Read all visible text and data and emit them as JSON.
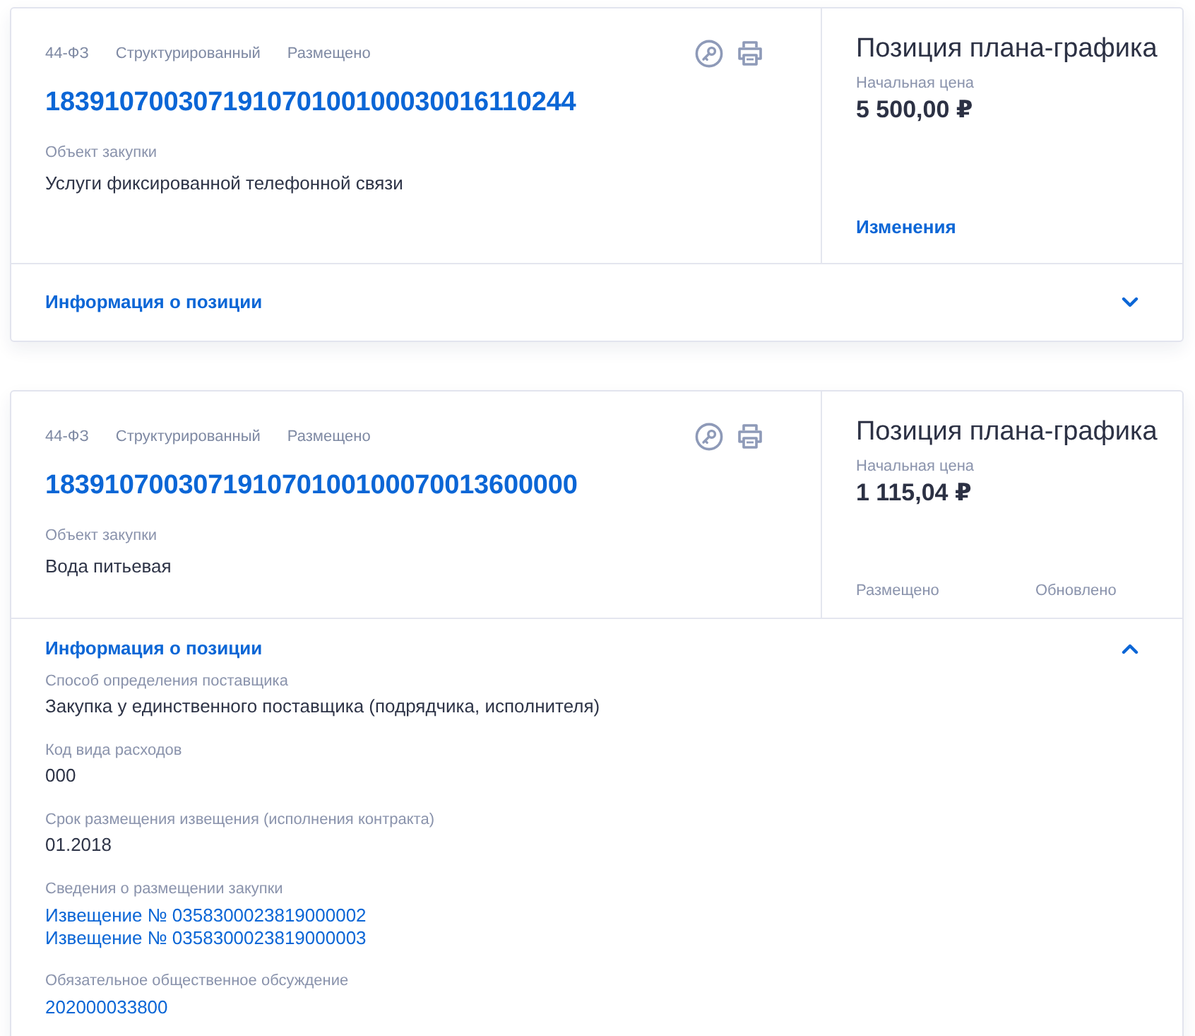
{
  "cards": [
    {
      "tags": [
        "44-ФЗ",
        "Структурированный",
        "Размещено"
      ],
      "number": "183910700307191070100100030016110244",
      "object_label": "Объект закупки",
      "object": "Услуги фиксированной телефонной связи",
      "side": {
        "title": "Позиция плана-графика",
        "price_label": "Начальная цена",
        "price": "5 500,00 ₽",
        "footer": [
          {
            "kind": "link",
            "text": "Изменения"
          }
        ]
      },
      "info": {
        "title": "Информация о позиции",
        "expanded": false
      }
    },
    {
      "tags": [
        "44-ФЗ",
        "Структурированный",
        "Размещено"
      ],
      "number": "183910700307191070100100070013600000",
      "object_label": "Объект закупки",
      "object": "Вода питьевая",
      "side": {
        "title": "Позиция плана-графика",
        "price_label": "Начальная цена",
        "price": "1 115,04 ₽",
        "footer": [
          {
            "kind": "status",
            "text": "Размещено"
          },
          {
            "kind": "status",
            "text": "Обновлено"
          }
        ]
      },
      "info": {
        "title": "Информация о позиции",
        "expanded": true,
        "fields": [
          {
            "label": "Способ определения поставщика",
            "values": [
              {
                "kind": "text",
                "text": "Закупка у единственного поставщика (подрядчика, исполнителя)"
              }
            ]
          },
          {
            "label": "Код вида расходов",
            "values": [
              {
                "kind": "text",
                "text": "000"
              }
            ]
          },
          {
            "label": "Срок размещения извещения (исполнения контракта)",
            "values": [
              {
                "kind": "text",
                "text": "01.2018"
              }
            ]
          },
          {
            "label": "Сведения о размещении закупки",
            "values": [
              {
                "kind": "link",
                "text": "Извещение № 0358300023819000002"
              },
              {
                "kind": "link",
                "text": "Извещение № 0358300023819000003"
              }
            ]
          },
          {
            "label": "Обязательное общественное обсуждение",
            "values": [
              {
                "kind": "link",
                "text": "202000033800"
              }
            ]
          }
        ]
      }
    }
  ]
}
